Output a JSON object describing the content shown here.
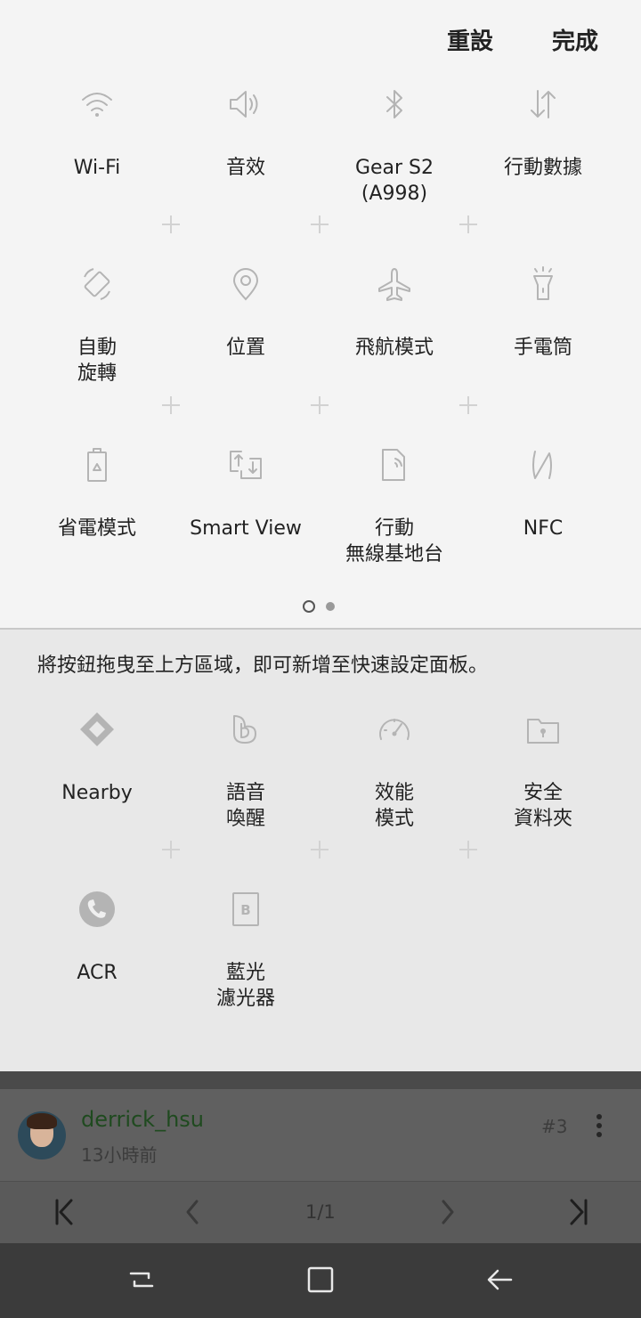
{
  "header": {
    "reset_label": "重設",
    "done_label": "完成"
  },
  "active_tiles": [
    {
      "label": "Wi-Fi",
      "icon": "wifi-icon"
    },
    {
      "label": "音效",
      "icon": "sound-icon"
    },
    {
      "label": "Gear S2\n(A998)",
      "icon": "bluetooth-icon"
    },
    {
      "label": "行動數據",
      "icon": "mobile-data-icon"
    },
    {
      "label": "自動\n旋轉",
      "icon": "auto-rotate-icon"
    },
    {
      "label": "位置",
      "icon": "location-icon"
    },
    {
      "label": "飛航模式",
      "icon": "airplane-icon"
    },
    {
      "label": "手電筒",
      "icon": "flashlight-icon"
    },
    {
      "label": "省電模式",
      "icon": "power-saving-icon"
    },
    {
      "label": "Smart View",
      "icon": "smart-view-icon"
    },
    {
      "label": "行動\n無線基地台",
      "icon": "hotspot-icon"
    },
    {
      "label": "NFC",
      "icon": "nfc-icon"
    }
  ],
  "page_indicator": {
    "pages": 2,
    "current": 1
  },
  "available": {
    "hint": "將按鈕拖曳至上方區域，即可新增至快速設定面板。",
    "tiles": [
      {
        "label": "Nearby",
        "icon": "nearby-icon"
      },
      {
        "label": "語音\n喚醒",
        "icon": "voice-wakeup-icon"
      },
      {
        "label": "效能\n模式",
        "icon": "performance-icon"
      },
      {
        "label": "安全\n資料夾",
        "icon": "secure-folder-icon"
      },
      {
        "label": "ACR",
        "icon": "acr-icon"
      },
      {
        "label": "藍光\n濾光器",
        "icon": "blue-light-filter-icon"
      }
    ]
  },
  "background_post": {
    "username": "derrick_hsu",
    "time": "13小時前",
    "post_number": "#3",
    "page_text": "1/1"
  },
  "colors": {
    "panel_top": "#f4f4f4",
    "panel_bottom": "#e8e8e8",
    "icon_gray": "#b4b4b4",
    "username_green": "#1f4a1f"
  }
}
